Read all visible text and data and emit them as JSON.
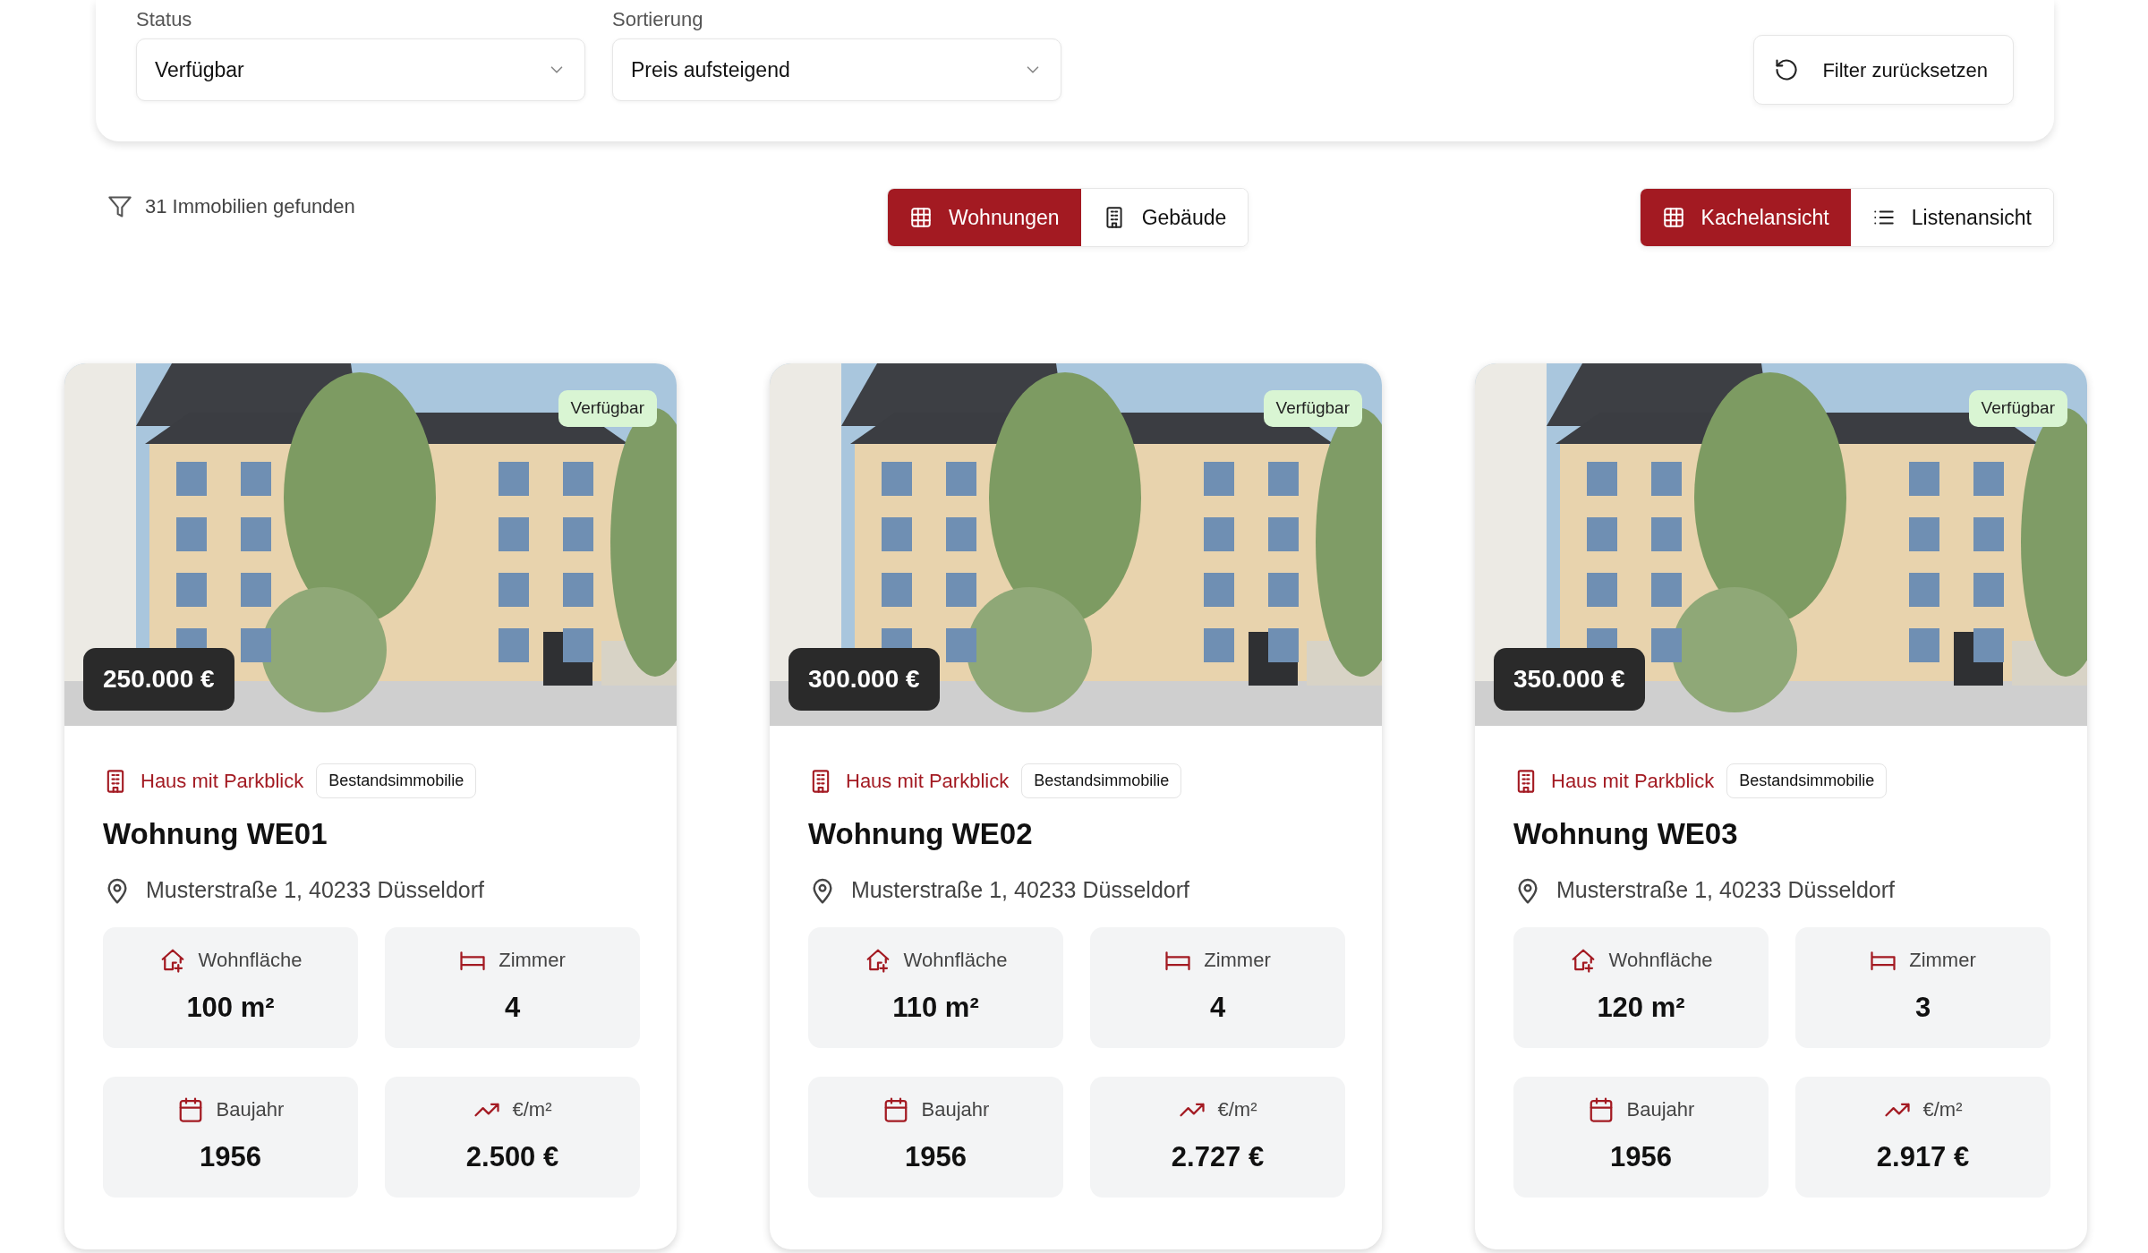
{
  "filters": [
    {
      "label": "Status",
      "value": "Verfügbar"
    },
    {
      "label": "Sortierung",
      "value": "Preis aufsteigend"
    }
  ],
  "reset_button": "Filter zurücksetzen",
  "result_count": "31 Immobilien gefunden",
  "type_toggle": [
    {
      "label": "Wohnungen",
      "kind": "grid",
      "selected": true
    },
    {
      "label": "Gebäude",
      "kind": "building",
      "selected": false
    }
  ],
  "view_toggle": [
    {
      "label": "Kachelansicht",
      "kind": "grid",
      "selected": true
    },
    {
      "label": "Listenansicht",
      "kind": "list",
      "selected": false
    }
  ],
  "cards": [
    {
      "status": "Verfügbar",
      "price": "250.000 €",
      "building": "Haus mit Parkblick",
      "tag": "Bestandsimmobilie",
      "title": "Wohnung WE01",
      "address": "Musterstraße 1, 40233 Düsseldorf",
      "stats": [
        {
          "kind": "area",
          "label": "Wohnfläche",
          "value": "100 m²"
        },
        {
          "kind": "rooms",
          "label": "Zimmer",
          "value": "4"
        },
        {
          "kind": "year",
          "label": "Baujahr",
          "value": "1956"
        },
        {
          "kind": "trend",
          "label": "€/m²",
          "value": "2.500 €"
        }
      ]
    },
    {
      "status": "Verfügbar",
      "price": "300.000 €",
      "building": "Haus mit Parkblick",
      "tag": "Bestandsimmobilie",
      "title": "Wohnung WE02",
      "address": "Musterstraße 1, 40233 Düsseldorf",
      "stats": [
        {
          "kind": "area",
          "label": "Wohnfläche",
          "value": "110 m²"
        },
        {
          "kind": "rooms",
          "label": "Zimmer",
          "value": "4"
        },
        {
          "kind": "year",
          "label": "Baujahr",
          "value": "1956"
        },
        {
          "kind": "trend",
          "label": "€/m²",
          "value": "2.727 €"
        }
      ]
    },
    {
      "status": "Verfügbar",
      "price": "350.000 €",
      "building": "Haus mit Parkblick",
      "tag": "Bestandsimmobilie",
      "title": "Wohnung WE03",
      "address": "Musterstraße 1, 40233 Düsseldorf",
      "stats": [
        {
          "kind": "area",
          "label": "Wohnfläche",
          "value": "120 m²"
        },
        {
          "kind": "rooms",
          "label": "Zimmer",
          "value": "3"
        },
        {
          "kind": "year",
          "label": "Baujahr",
          "value": "1956"
        },
        {
          "kind": "trend",
          "label": "€/m²",
          "value": "2.917 €"
        }
      ]
    }
  ]
}
